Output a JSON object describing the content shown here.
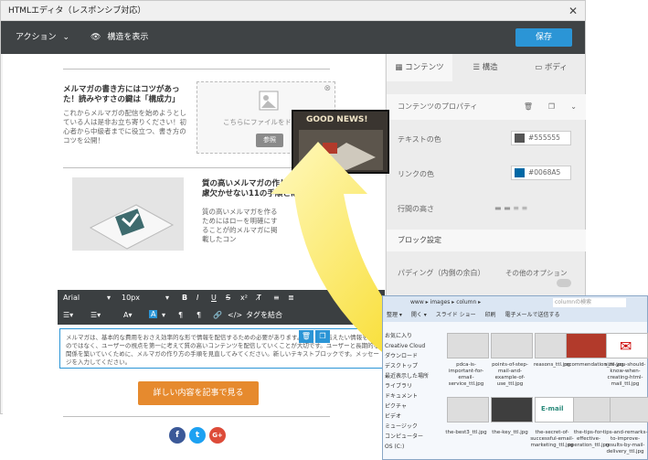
{
  "window": {
    "title": "HTMLエディタ（レスポンシブ対応）",
    "close": "✕"
  },
  "toolbar": {
    "action_label": "アクション",
    "structure_label": "構造を表示",
    "save_label": "保存"
  },
  "editor": {
    "article1_title": "メルマガの書き方にはコツがあった！読みやすさの鍵は「構成力」",
    "article1_body": "これからメルマガの配信を始めようとしている人は是非お立ち寄りください！初心者から中級者までに役立つ、書き方のコツを公開！",
    "dropzone_text": "こちらにファイルをド",
    "dropzone_button": "参照",
    "article2_title": "質の高いメルマガの作り方と配慮欠かせない11の手順とは？",
    "article2_body": "質の高いメルマガを作るためにはローを明確にすることが的メルマガに掲載したコン",
    "format": {
      "font": "Arial",
      "size": "10px",
      "combine_tags": "タグを結合"
    },
    "selected_text": "メルマガは、基本的な費用をおさえ効率的な形で情報を配信するための必要があります。ここで、伝えたい情報を行うのではなく、ユーザーの視点を第一に考えて質の高いコンテンツを配信していくことが大切です。ユーザーと長期的な関係を築いていくために、メルマガの作り方の手順を見直してみてください。新しいテキストブロックです。メッセージを入力してください。",
    "cta_label": "詳しい内容を記事で見る",
    "social": {
      "facebook": "f",
      "twitter": "t",
      "google": "G+"
    }
  },
  "panel": {
    "tabs": [
      "コンテンツ",
      "構造",
      "ボディ"
    ],
    "props_title": "コンテンツのプロパティ",
    "text_color_label": "テキストの色",
    "text_color_value": "#555555",
    "link_color_label": "リンクの色",
    "link_color_value": "#0068A5",
    "line_height_label": "行間の高さ",
    "block_settings": "ブロック設定",
    "padding_label": "パディング（内側の余白）",
    "other_options": "その他のオプション",
    "colors": {
      "text": "#555555",
      "link": "#0068A5",
      "accent": "#2b95d6",
      "cta": "#e68a2e"
    }
  },
  "overlay": {
    "news_label": "GOOD NEWS!"
  },
  "explorer": {
    "path": "www ▸ images ▸ column ▸",
    "search": "columnの検索",
    "menu": [
      "整理 ▾",
      "開く ▾",
      "スライド ショー",
      "印刷",
      "電子メールで送信する"
    ],
    "tree": [
      "お気に入り",
      "Creative Cloud",
      "ダウンロード",
      "デスクトップ",
      "最近表示した場所",
      "ライブラリ",
      "ドキュメント",
      "ピクチャ",
      "ビデオ",
      "ミュージック",
      "コンピューター",
      "OS (C:)"
    ],
    "files_row1": [
      "pdca-is-important-for-email-service_ttl.jpg",
      "points-of-step-mail-and-example-of-use_ttl.jpg",
      "reasons_ttl.jpg",
      "recommendation_ttl.jpg",
      "size-you-should-know-when-creating-html-mail_ttl.jpg"
    ],
    "files_row2": [
      "the-best3_ttl.jpg",
      "the-key_ttl.jpg",
      "the-secret-of-successful-email-marketing_ttl.jpg",
      "the-tips-for-effective-operation_ttl.jpg",
      "tips-and-remarks-to-improve-results-by-mail-delivery_ttl.jpg"
    ],
    "email_thumb_text": "E-mail"
  }
}
